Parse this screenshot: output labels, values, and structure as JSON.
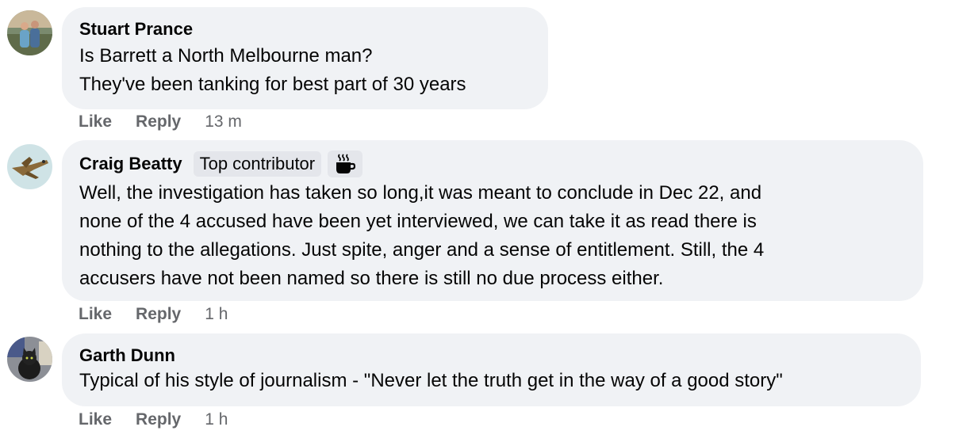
{
  "comments": [
    {
      "author": "Stuart Prance",
      "lines": [
        "Is Barrett a North Melbourne man?",
        "They've been tanking for best part of 30 years"
      ],
      "like_label": "Like",
      "reply_label": "Reply",
      "time": "13 m"
    },
    {
      "author": "Craig Beatty",
      "badge": "Top contributor",
      "badge_icon": "coffee-cup-icon",
      "lines": [
        "Well, the investigation has taken so long,it was meant to conclude in Dec 22, and",
        "none of the 4 accused have been yet interviewed, we can take it as read there is",
        "nothing to the allegations. Just spite, anger and a sense of entitlement. Still, the 4",
        "accusers have not been named so there is still no due process either."
      ],
      "like_label": "Like",
      "reply_label": "Reply",
      "time": "1 h"
    },
    {
      "author": "Garth Dunn",
      "lines": [
        "Typical of his style of journalism - \"Never let the truth get in the way of a good story\""
      ],
      "like_label": "Like",
      "reply_label": "Reply",
      "time": "1 h"
    }
  ],
  "colors": {
    "bubble_bg": "#f0f2f5",
    "badge_bg": "#e4e6eb",
    "text": "#050505",
    "secondary_text": "#65676b"
  }
}
